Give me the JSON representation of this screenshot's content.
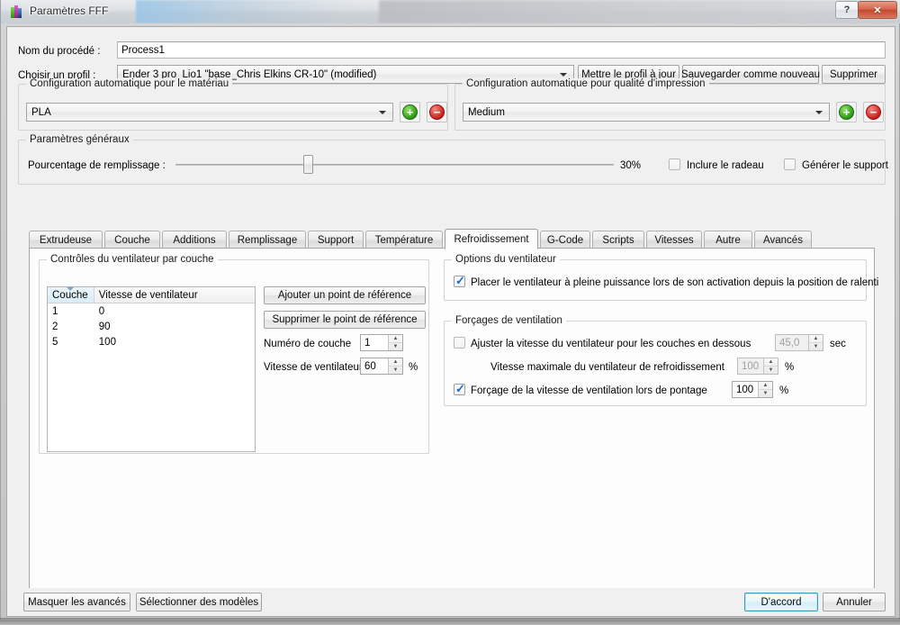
{
  "window": {
    "title": "Paramètres FFF",
    "icon": "fff-bars-icon",
    "help_label": "?",
    "close_label": "✕"
  },
  "header": {
    "process_name_label": "Nom du procédé :",
    "process_name_value": "Process1",
    "profile_label": "Choisir un profil :",
    "profile_value": "Ender 3 pro_Lio1 \"base_Chris Elkins CR-10\" (modified)",
    "update_profile_button": "Mettre le profil à jour",
    "save_as_new_button": "Sauvegarder comme nouveau",
    "delete_button": "Supprimer"
  },
  "material_group": {
    "title": "Configuration automatique pour le matériau",
    "value": "PLA",
    "add_button": "+",
    "remove_button": "−"
  },
  "quality_group": {
    "title": "Configuration automatique pour qualité d'impression",
    "value": "Medium",
    "add_button": "+",
    "remove_button": "−"
  },
  "general_group": {
    "title": "Paramètres généraux",
    "infill_label": "Pourcentage de remplissage :",
    "infill_value": "30%",
    "infill_percent": 30,
    "raft_checkbox_label": "Inclure le radeau",
    "raft_checked": false,
    "support_checkbox_label": "Générer le support",
    "support_checked": false
  },
  "tabs": [
    {
      "label": "Extrudeuse",
      "active": false
    },
    {
      "label": "Couche",
      "active": false
    },
    {
      "label": "Additions",
      "active": false
    },
    {
      "label": "Remplissage",
      "active": false
    },
    {
      "label": "Support",
      "active": false
    },
    {
      "label": "Température",
      "active": false
    },
    {
      "label": "Refroidissement",
      "active": true
    },
    {
      "label": "G-Code",
      "active": false
    },
    {
      "label": "Scripts",
      "active": false
    },
    {
      "label": "Vitesses",
      "active": false
    },
    {
      "label": "Autre",
      "active": false
    },
    {
      "label": "Avancés",
      "active": false
    }
  ],
  "fan_controls": {
    "title": "Contrôles du ventilateur par couche",
    "columns": [
      "Couche",
      "Vitesse de ventilateur"
    ],
    "sorted_column": "Couche",
    "rows": [
      {
        "layer": "1",
        "speed": "0"
      },
      {
        "layer": "2",
        "speed": "90"
      },
      {
        "layer": "5",
        "speed": "100"
      }
    ],
    "add_setpoint_button": "Ajouter un point de référence",
    "remove_setpoint_button": "Supprimer le point de référence",
    "layer_number_label": "Numéro de couche",
    "layer_number_value": "1",
    "fan_speed_label": "Vitesse de ventilateur",
    "fan_speed_value": "60",
    "fan_speed_unit": "%"
  },
  "fan_options": {
    "title": "Options du ventilateur",
    "full_power_label": "Placer le ventilateur à pleine puissance lors de son activation depuis la position de ralenti",
    "full_power_checked": true
  },
  "fan_overrides": {
    "title": "Forçages de ventilation",
    "adjust_speed_label": "Ajuster la vitesse du ventilateur pour les couches en dessous",
    "adjust_speed_checked": false,
    "adjust_speed_value": "45,0",
    "adjust_speed_unit": "sec",
    "max_speed_label": "Vitesse maximale du ventilateur de refroidissement",
    "max_speed_value": "100",
    "max_speed_unit": "%",
    "bridging_label": "Forçage de la vitesse de ventilation lors de pontage",
    "bridging_checked": true,
    "bridging_value": "100",
    "bridging_unit": "%"
  },
  "footer": {
    "hide_advanced_button": "Masquer les avancés",
    "select_models_button": "Sélectionner des modèles",
    "ok_button": "D'accord",
    "cancel_button": "Annuler"
  }
}
